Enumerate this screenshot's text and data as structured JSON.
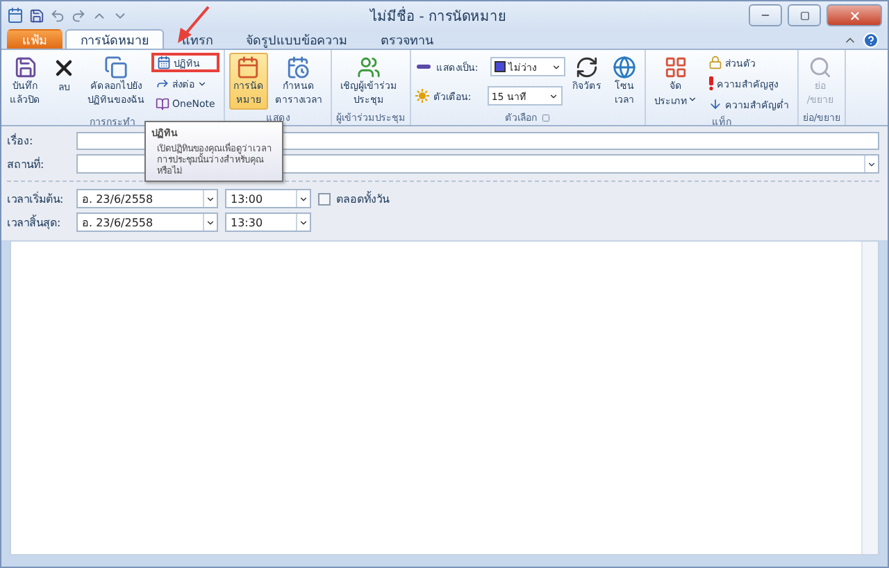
{
  "window": {
    "title": "ไม่มีชื่อ - การนัดหมาย"
  },
  "tabs": [
    {
      "label": "แฟ้ม",
      "kind": "file",
      "selected": false
    },
    {
      "label": "การนัดหมาย",
      "kind": "tab",
      "selected": true
    },
    {
      "label": "แทรก",
      "kind": "tab",
      "selected": false
    },
    {
      "label": "จัดรูปแบบข้อความ",
      "kind": "tab",
      "selected": false
    },
    {
      "label": "ตรวจทาน",
      "kind": "tab",
      "selected": false
    }
  ],
  "ribbon": {
    "groups": [
      {
        "label": "การกระทำ",
        "items": [
          {
            "kind": "large",
            "lines": [
              "บันทึก",
              "แล้วปิด"
            ]
          },
          {
            "kind": "large",
            "lines": [
              "ลบ"
            ]
          },
          {
            "kind": "large",
            "lines": [
              "คัดลอกไปยัง",
              "ปฏิทินของฉัน"
            ]
          },
          {
            "kind": "stack",
            "items": [
              {
                "kind": "small",
                "label": "ปฏิทิน",
                "outlined": true
              },
              {
                "kind": "small",
                "label": "ส่งต่อ",
                "dropdown": true
              },
              {
                "kind": "small",
                "label": "OneNote"
              }
            ]
          }
        ]
      },
      {
        "label": "แสดง",
        "items": [
          {
            "kind": "large",
            "lines": [
              "การนัด",
              "หมาย"
            ],
            "selected": true
          },
          {
            "kind": "large",
            "lines": [
              "กำหนด",
              "ตารางเวลา"
            ],
            "selected": false
          }
        ]
      },
      {
        "label": "ผู้เข้าร่วมประชุม",
        "items": [
          {
            "kind": "large",
            "lines": [
              "เชิญผู้เข้าร่วม",
              "ประชุม"
            ]
          }
        ]
      },
      {
        "label": "ตัวเลือก",
        "launcher": true,
        "items": [
          {
            "kind": "stack",
            "items": [
              {
                "kind": "select",
                "label": "แสดงเป็น:",
                "value": "ไม่ว่าง",
                "color": "#4a4ad8"
              },
              {
                "kind": "select",
                "label": "ตัวเตือน:",
                "value": "15 นาที"
              }
            ]
          },
          {
            "kind": "large",
            "lines": [
              "กิจวัตร"
            ]
          },
          {
            "kind": "large",
            "lines": [
              "โซน",
              "เวลา"
            ]
          }
        ]
      },
      {
        "label": "แท็ก",
        "items": [
          {
            "kind": "large",
            "lines": [
              "จัด",
              "ประเภท"
            ],
            "dropdown": true
          },
          {
            "kind": "stack",
            "items": [
              {
                "kind": "small",
                "label": "ส่วนตัว"
              },
              {
                "kind": "small",
                "label": "ความสำคัญสูง"
              },
              {
                "kind": "small",
                "label": "ความสำคัญต่ำ"
              }
            ]
          }
        ]
      },
      {
        "label": "ย่อ/ขยาย",
        "items": [
          {
            "kind": "large",
            "lines": [
              "ย่อ",
              "/ขยาย"
            ],
            "disabled": true
          }
        ]
      }
    ]
  },
  "tooltip": {
    "title": "ปฏิทิน",
    "text": "เปิดปฏิทินของคุณเพื่อดูว่าเวลาการประชุมนั้นว่างสำหรับคุณหรือไม่"
  },
  "form": {
    "subject": {
      "label": "เรื่อง:"
    },
    "location": {
      "label": "สถานที่:"
    },
    "times": [
      {
        "label": "เวลาเริ่มต้น:",
        "date": "อ. 23/6/2558",
        "time": "13:00"
      },
      {
        "label": "เวลาสิ้นสุด:",
        "date": "อ. 23/6/2558",
        "time": "13:30"
      }
    ],
    "all_day": {
      "label": "ตลอดทั้งวัน",
      "checked": false
    }
  }
}
